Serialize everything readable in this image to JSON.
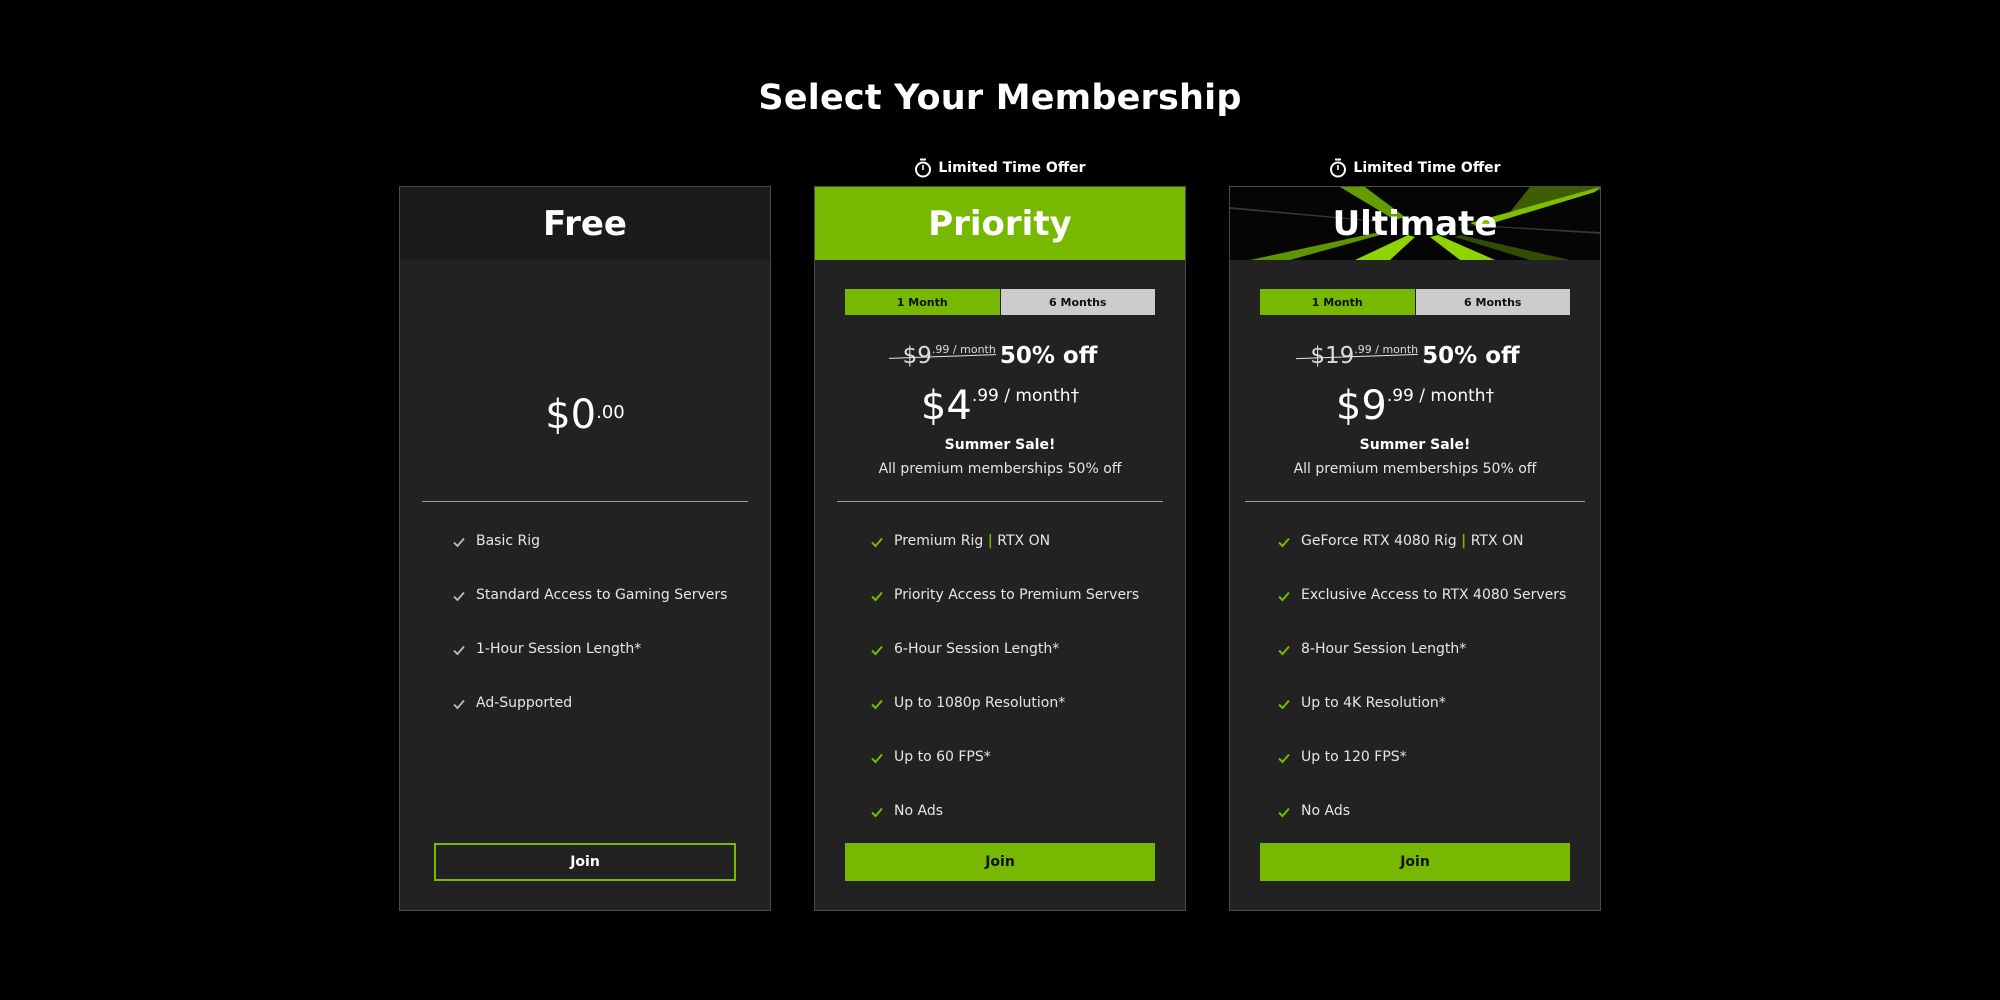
{
  "page": {
    "title": "Select Your Membership"
  },
  "accent_color": "#76b900",
  "plans": [
    {
      "name": "Free",
      "offer_label": null,
      "price": {
        "dollars": "$0",
        "cents": ".00"
      },
      "features": [
        {
          "text": "Basic Rig"
        },
        {
          "text": "Standard Access to Gaming Servers"
        },
        {
          "text": "1-Hour Session Length*"
        },
        {
          "text": "Ad-Supported"
        }
      ],
      "join_label": "Join"
    },
    {
      "name": "Priority",
      "offer_label": "Limited Time Offer",
      "offer_icon": "stopwatch-icon",
      "toggle": {
        "options": [
          "1 Month",
          "6 Months"
        ],
        "selected": "1 Month"
      },
      "old_price": {
        "dollars": "$9",
        "suffix": ".99 / month"
      },
      "discount": "50% off",
      "price": {
        "dollars": "$4",
        "suffix": ".99 / month†"
      },
      "sale_title": "Summer Sale!",
      "sale_subtitle": "All premium memberships 50% off",
      "features": [
        {
          "text": "Premium Rig",
          "sep": "|",
          "text2": "RTX ON"
        },
        {
          "text": "Priority Access to Premium Servers"
        },
        {
          "text": "6-Hour Session Length*"
        },
        {
          "text": "Up to 1080p Resolution*"
        },
        {
          "text": "Up to 60 FPS*"
        },
        {
          "text": "No Ads"
        }
      ],
      "join_label": "Join"
    },
    {
      "name": "Ultimate",
      "offer_label": "Limited Time Offer",
      "offer_icon": "stopwatch-icon",
      "toggle": {
        "options": [
          "1 Month",
          "6 Months"
        ],
        "selected": "1 Month"
      },
      "old_price": {
        "dollars": "$19",
        "suffix": ".99 / month"
      },
      "discount": "50% off",
      "price": {
        "dollars": "$9",
        "suffix": ".99 / month†"
      },
      "sale_title": "Summer Sale!",
      "sale_subtitle": "All premium memberships 50% off",
      "features": [
        {
          "text": "GeForce RTX 4080 Rig",
          "sep": "|",
          "text2": "RTX ON"
        },
        {
          "text": "Exclusive Access to RTX 4080 Servers"
        },
        {
          "text": "8-Hour Session Length*"
        },
        {
          "text": "Up to 4K Resolution*"
        },
        {
          "text": "Up to 120 FPS*"
        },
        {
          "text": "No Ads"
        }
      ],
      "join_label": "Join"
    }
  ]
}
